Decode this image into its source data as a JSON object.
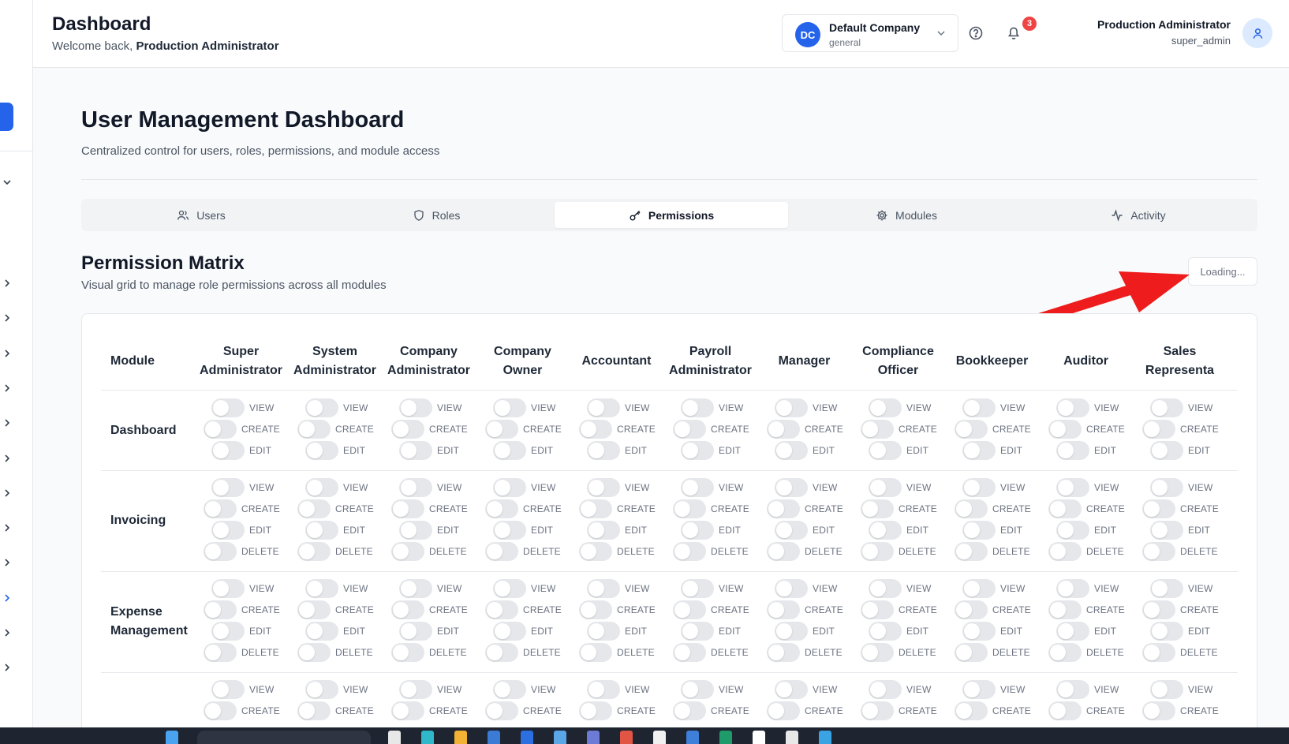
{
  "header": {
    "title": "Dashboard",
    "welcome_prefix": "Welcome back, ",
    "welcome_user": "Production Administrator",
    "company": {
      "initials": "DC",
      "name": "Default Company",
      "type": "general"
    },
    "notifications_count": "3",
    "user": {
      "name": "Production Administrator",
      "role": "super_admin"
    }
  },
  "page": {
    "title": "User Management Dashboard",
    "subtitle": "Centralized control for users, roles, permissions, and module access"
  },
  "tabs": [
    {
      "label": "Users",
      "icon": "users-icon"
    },
    {
      "label": "Roles",
      "icon": "shield-icon"
    },
    {
      "label": "Permissions",
      "icon": "key-icon",
      "active": true
    },
    {
      "label": "Modules",
      "icon": "gear-icon"
    },
    {
      "label": "Activity",
      "icon": "activity-icon"
    }
  ],
  "matrix": {
    "title": "Permission Matrix",
    "subtitle": "Visual grid to manage role permissions across all modules",
    "loading_label": "Loading...",
    "module_header": "Module",
    "roles": [
      [
        "Super",
        "Administrator"
      ],
      [
        "System",
        "Administrator"
      ],
      [
        "Company",
        "Administrator"
      ],
      [
        "Company",
        "Owner"
      ],
      [
        "Accountant"
      ],
      [
        "Payroll",
        "Administrator"
      ],
      [
        "Manager"
      ],
      [
        "Compliance",
        "Officer"
      ],
      [
        "Bookkeeper"
      ],
      [
        "Auditor"
      ],
      [
        "Sales",
        "Representa"
      ]
    ],
    "modules": [
      {
        "name": [
          "Dashboard"
        ],
        "permissions": [
          "VIEW",
          "CREATE",
          "EDIT"
        ]
      },
      {
        "name": [
          "Invoicing"
        ],
        "permissions": [
          "VIEW",
          "CREATE",
          "EDIT",
          "DELETE"
        ]
      },
      {
        "name": [
          "Expense",
          "Management"
        ],
        "permissions": [
          "VIEW",
          "CREATE",
          "EDIT",
          "DELETE"
        ]
      },
      {
        "name": [],
        "permissions": [
          "VIEW",
          "CREATE"
        ]
      }
    ]
  },
  "colors": {
    "accent": "#2563eb",
    "badge": "#ef4444",
    "annotation_arrow": "#ee1c1c"
  }
}
